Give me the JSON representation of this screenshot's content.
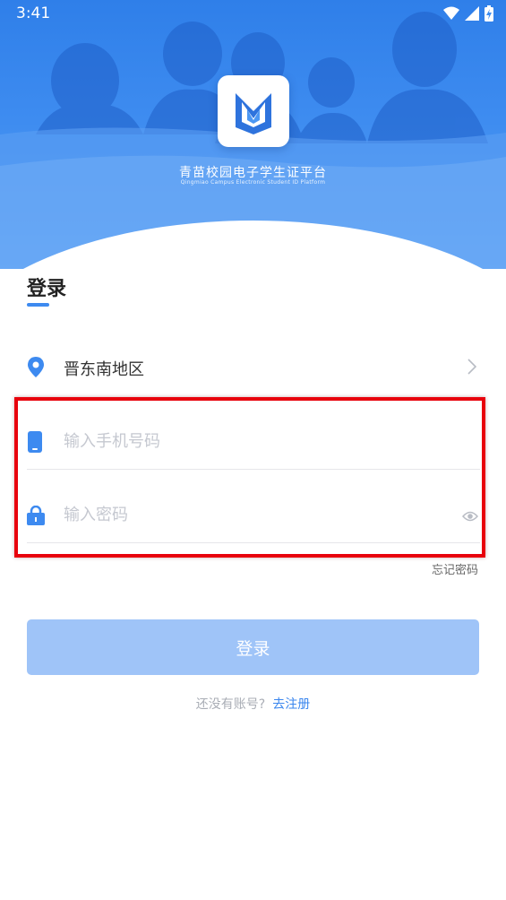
{
  "status_bar": {
    "time": "3:41"
  },
  "app": {
    "title": "青苗校园电子学生证平台",
    "subtitle": "Qingmiao Campus Electronic Student ID Platform",
    "logo_icon": "qingmiao-logo"
  },
  "login": {
    "heading": "登录",
    "region": {
      "label": "晋东南地区",
      "icon": "location-pin-icon"
    },
    "phone": {
      "placeholder": "输入手机号码",
      "value": "",
      "icon": "phone-icon"
    },
    "password": {
      "placeholder": "输入密码",
      "value": "",
      "icon": "lock-icon",
      "toggle_icon": "eye-icon"
    },
    "forgot_label": "忘记密码",
    "submit_label": "登录",
    "no_account_text": "还没有账号?",
    "register_label": "去注册"
  },
  "colors": {
    "accent": "#3d8af0",
    "button_disabled": "#9fc4f8",
    "highlight": "#e8000c"
  }
}
